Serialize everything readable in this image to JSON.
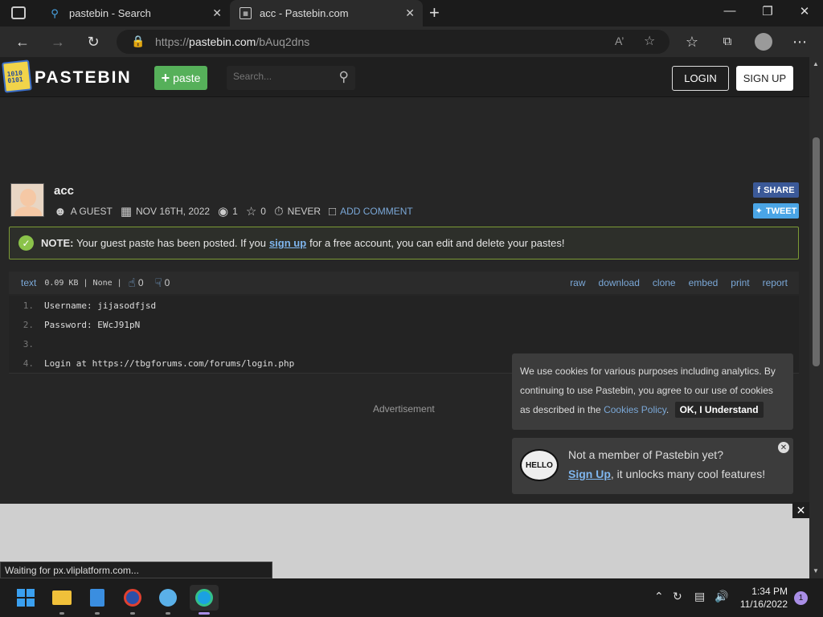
{
  "browser": {
    "tabs": [
      {
        "title": "pastebin - Search"
      },
      {
        "title": "acc - Pastebin.com"
      }
    ],
    "url_prefix": "https://",
    "url_host": "pastebin.com",
    "url_path": "/bAuq2dns"
  },
  "site": {
    "brand": "PASTEBIN",
    "logo_text": "1010 0101",
    "paste_button": "paste",
    "search_placeholder": "Search...",
    "login": "LOGIN",
    "signup": "SIGN UP"
  },
  "paste": {
    "title": "acc",
    "author": "A GUEST",
    "date": "NOV 16TH, 2022",
    "views": "1",
    "stars": "0",
    "expires": "NEVER",
    "add_comment": "ADD COMMENT",
    "share": "SHARE",
    "tweet": "TWEET"
  },
  "note": {
    "label": "NOTE:",
    "pre": "Your guest paste has been posted. If you",
    "link": "sign up",
    "post": "for a free account, you can edit and delete your pastes!"
  },
  "code": {
    "lang": "text",
    "info": "0.09 KB | None |",
    "likes": "0",
    "dislikes": "0",
    "actions": [
      "raw",
      "download",
      "clone",
      "embed",
      "print",
      "report"
    ],
    "lines": [
      {
        "n": "1.",
        "text": "Username: jijasodfjsd"
      },
      {
        "n": "2.",
        "text": "Password: EWcJ91pN"
      },
      {
        "n": "3.",
        "text": ""
      },
      {
        "n": "4.",
        "text": "Login at https://tbgforums.com/forums/login.php"
      }
    ]
  },
  "advertisement": "Advertisement",
  "cookie": {
    "text": "We use cookies for various purposes including analytics. By continuing to use Pastebin, you agree to our use of cookies as described in the",
    "policy": "Cookies Policy",
    "dot": ".",
    "ok": "OK, I Understand"
  },
  "member": {
    "hello": "HELLO",
    "line1": "Not a member of Pastebin yet?",
    "link": "Sign Up",
    "line2": ", it unlocks many cool features!"
  },
  "status": "Waiting for px.vliplatform.com...",
  "taskbar": {
    "time": "1:34 PM",
    "date": "11/16/2022",
    "notifications": "1"
  }
}
